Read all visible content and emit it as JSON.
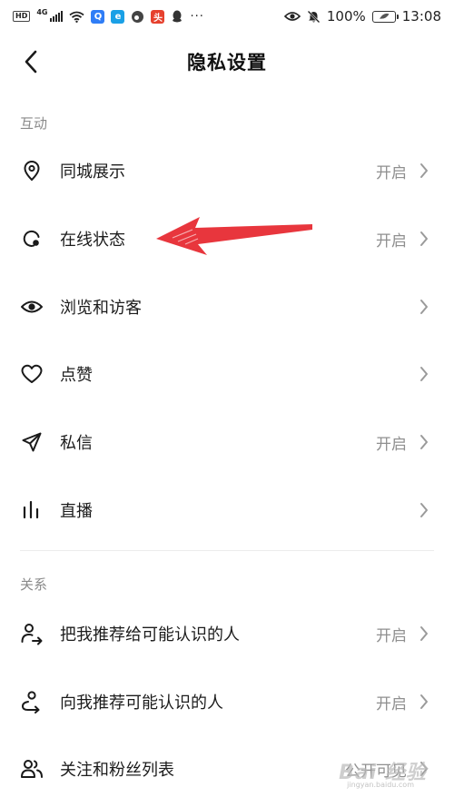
{
  "status_bar": {
    "hd_badge": "HD",
    "network": "4G",
    "battery_text": "100%",
    "time": "13:08",
    "more_dots": "···"
  },
  "header": {
    "title": "隐私设置"
  },
  "sections": {
    "interaction": {
      "title": "互动",
      "rows": [
        {
          "label": "同城展示",
          "value": "开启",
          "icon": "location-pin-icon"
        },
        {
          "label": "在线状态",
          "value": "开启",
          "icon": "online-status-icon"
        },
        {
          "label": "浏览和访客",
          "value": "",
          "icon": "eye-icon"
        },
        {
          "label": "点赞",
          "value": "",
          "icon": "heart-icon"
        },
        {
          "label": "私信",
          "value": "开启",
          "icon": "paper-plane-icon"
        },
        {
          "label": "直播",
          "value": "",
          "icon": "live-bars-icon"
        }
      ]
    },
    "relations": {
      "title": "关系",
      "rows": [
        {
          "label": "把我推荐给可能认识的人",
          "value": "开启",
          "icon": "user-share-icon"
        },
        {
          "label": "向我推荐可能认识的人",
          "value": "开启",
          "icon": "user-recommend-icon"
        },
        {
          "label": "关注和粉丝列表",
          "value": "公开可见",
          "icon": "users-icon"
        }
      ]
    }
  },
  "watermark": {
    "text": "Bai 经验",
    "sub": "jingyan.baidu.com"
  },
  "colors": {
    "arrow": "#e8363d",
    "label": "#1c1c1c",
    "secondary": "#8f8f8f"
  }
}
